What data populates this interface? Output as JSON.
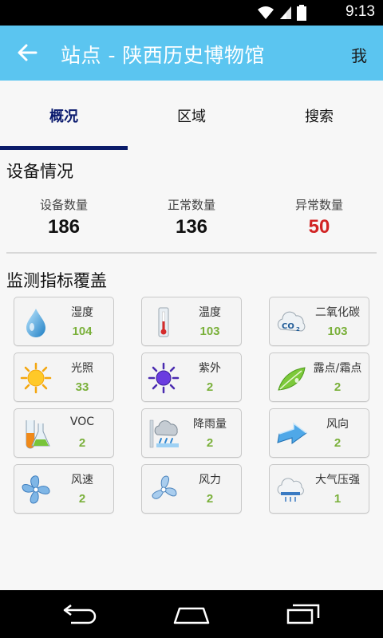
{
  "status_bar": {
    "time": "9:13"
  },
  "app_bar": {
    "title": "站点 - 陕西历史博物馆",
    "me_label": "我"
  },
  "tabs": [
    {
      "label": "概况",
      "active": true
    },
    {
      "label": "区域",
      "active": false
    },
    {
      "label": "搜索",
      "active": false
    }
  ],
  "device_section": {
    "title": "设备情况",
    "stats": [
      {
        "label": "设备数量",
        "value": "186"
      },
      {
        "label": "正常数量",
        "value": "136"
      },
      {
        "label": "异常数量",
        "value": "50"
      }
    ]
  },
  "coverage_section": {
    "title": "监测指标覆盖",
    "items": [
      {
        "label": "湿度",
        "value": "104",
        "icon": "water-drop-icon"
      },
      {
        "label": "温度",
        "value": "103",
        "icon": "thermometer-icon"
      },
      {
        "label": "二氧化碳",
        "value": "103",
        "icon": "co2-cloud-icon"
      },
      {
        "label": "光照",
        "value": "33",
        "icon": "sun-icon"
      },
      {
        "label": "紫外",
        "value": "2",
        "icon": "uv-sun-icon"
      },
      {
        "label": "露点/霜点",
        "value": "2",
        "icon": "leaf-drop-icon"
      },
      {
        "label": "VOC",
        "value": "2",
        "icon": "flask-icon"
      },
      {
        "label": "降雨量",
        "value": "2",
        "icon": "rain-cloud-icon"
      },
      {
        "label": "风向",
        "value": "2",
        "icon": "wind-arrow-icon"
      },
      {
        "label": "风速",
        "value": "2",
        "icon": "fan-icon"
      },
      {
        "label": "风力",
        "value": "2",
        "icon": "fan-icon"
      },
      {
        "label": "大气压强",
        "value": "1",
        "icon": "pressure-cloud-icon"
      }
    ]
  },
  "colors": {
    "app_bar": "#5bc5f0",
    "tab_indicator": "#0b1c6a",
    "alert_value": "#d12424",
    "card_value": "#7ab03a"
  }
}
